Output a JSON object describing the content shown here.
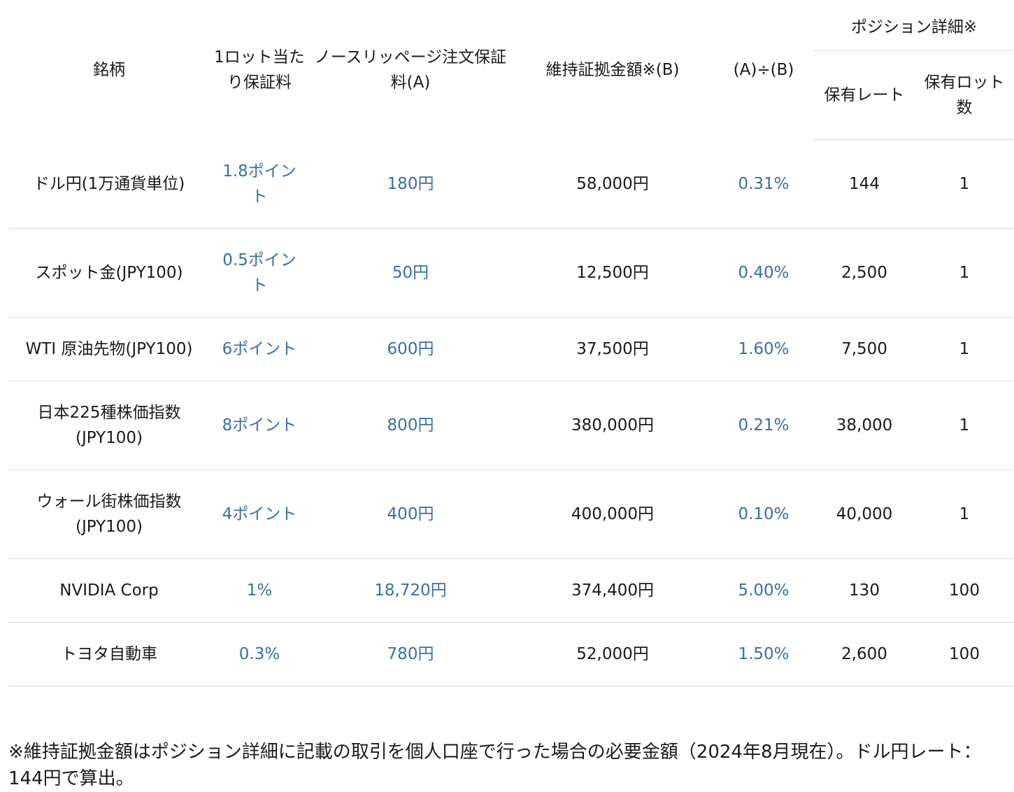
{
  "headers": {
    "symbol": "銘柄",
    "margin_per_lot": "1ロット当たり保証料",
    "no_slippage": "ノースリッページ注文保証料(A)",
    "maintenance": "維持証拠金額※(B)",
    "ratio": "(A)÷(B)",
    "position_group": "ポジション詳細※",
    "held_rate": "保有レート",
    "held_lots": "保有ロット数"
  },
  "rows": [
    {
      "symbol": "ドル円(1万通貨単位)",
      "margin_per_lot": "1.8ポイント",
      "no_slippage": "180円",
      "maintenance": "58,000円",
      "ratio": "0.31%",
      "held_rate": "144",
      "held_lots": "1"
    },
    {
      "symbol": "スポット金(JPY100)",
      "margin_per_lot": "0.5ポイント",
      "no_slippage": "50円",
      "maintenance": "12,500円",
      "ratio": "0.40%",
      "held_rate": "2,500",
      "held_lots": "1"
    },
    {
      "symbol": "WTI 原油先物(JPY100)",
      "margin_per_lot": "6ポイント",
      "no_slippage": "600円",
      "maintenance": "37,500円",
      "ratio": "1.60%",
      "held_rate": "7,500",
      "held_lots": "1"
    },
    {
      "symbol": "日本225種株価指数(JPY100)",
      "margin_per_lot": "8ポイント",
      "no_slippage": "800円",
      "maintenance": "380,000円",
      "ratio": "0.21%",
      "held_rate": "38,000",
      "held_lots": "1"
    },
    {
      "symbol": "ウォール街株価指数(JPY100)",
      "margin_per_lot": "4ポイント",
      "no_slippage": "400円",
      "maintenance": "400,000円",
      "ratio": "0.10%",
      "held_rate": "40,000",
      "held_lots": "1"
    },
    {
      "symbol": "NVIDIA Corp",
      "margin_per_lot": "1%",
      "no_slippage": "18,720円",
      "maintenance": "374,400円",
      "ratio": "5.00%",
      "held_rate": "130",
      "held_lots": "100"
    },
    {
      "symbol": "トヨタ自動車",
      "margin_per_lot": "0.3%",
      "no_slippage": "780円",
      "maintenance": "52,000円",
      "ratio": "1.50%",
      "held_rate": "2,600",
      "held_lots": "100"
    }
  ],
  "footnote": "※維持証拠金額はポジション詳細に記載の取引を個人口座で行った場合の必要金額（2024年8月現在）。ドル円レート：144円で算出。"
}
